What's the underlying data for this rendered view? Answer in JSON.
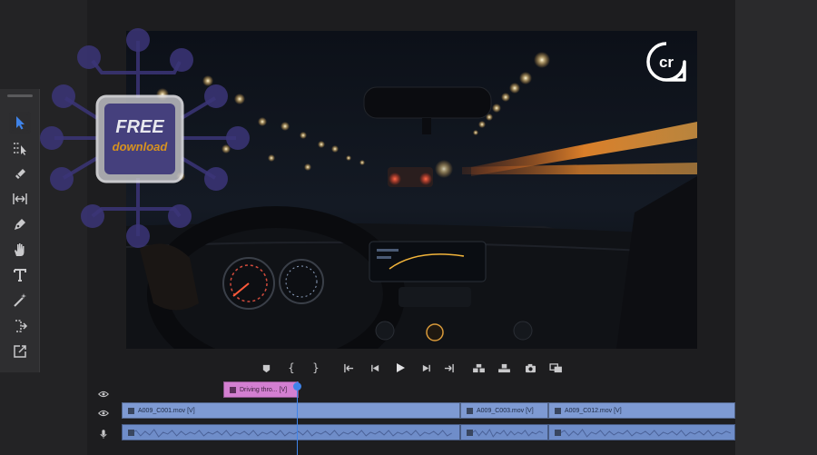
{
  "watermark": {
    "line1": "FREE",
    "line2": "download",
    "logo_text": "cr"
  },
  "tools": [
    {
      "name": "selection-tool",
      "icon": "arrow-pointer-icon",
      "active": true
    },
    {
      "name": "track-select-tool",
      "icon": "track-select-icon",
      "active": false
    },
    {
      "name": "razor-tool",
      "icon": "razor-icon",
      "active": false
    },
    {
      "name": "slip-tool",
      "icon": "slip-icon",
      "active": false
    },
    {
      "name": "pen-tool",
      "icon": "pen-icon",
      "active": false
    },
    {
      "name": "hand-tool",
      "icon": "hand-icon",
      "active": false
    },
    {
      "name": "type-tool",
      "icon": "type-icon",
      "active": false
    },
    {
      "name": "remix-tool",
      "icon": "magic-wand-icon",
      "active": false
    },
    {
      "name": "generative-extend-tool",
      "icon": "extend-icon",
      "active": false
    },
    {
      "name": "export-tool",
      "icon": "export-icon",
      "active": false
    }
  ],
  "transport": [
    {
      "name": "add-marker-button",
      "icon": "marker-icon",
      "glyph": "⬟"
    },
    {
      "name": "mark-in-button",
      "icon": "mark-in-icon",
      "glyph": "{"
    },
    {
      "name": "mark-out-button",
      "icon": "mark-out-icon",
      "glyph": "}"
    },
    {
      "name": "go-to-in-button",
      "icon": "go-to-in-icon",
      "glyph": "⇤"
    },
    {
      "name": "step-back-button",
      "icon": "step-back-icon",
      "glyph": "◀"
    },
    {
      "name": "play-button",
      "icon": "play-icon",
      "glyph": "▶"
    },
    {
      "name": "step-forward-button",
      "icon": "step-forward-icon",
      "glyph": "▶"
    },
    {
      "name": "go-to-out-button",
      "icon": "go-to-out-icon",
      "glyph": "⇥"
    },
    {
      "name": "insert-button",
      "icon": "insert-icon",
      "glyph": "⊞"
    },
    {
      "name": "overwrite-button",
      "icon": "overwrite-icon",
      "glyph": "⊟"
    },
    {
      "name": "export-frame-button",
      "icon": "camera-icon",
      "glyph": "◉"
    },
    {
      "name": "comparison-view-button",
      "icon": "comparison-icon",
      "glyph": "▣"
    }
  ],
  "timeline": {
    "title_clip": "Driving thro... [V]",
    "video_clips": [
      "A009_C001.mov [V]",
      "A009_C003.mov [V]",
      "A009_C012.mov [V]"
    ],
    "track_icons": [
      "eye-icon",
      "eye-icon",
      "microphone-icon"
    ]
  },
  "colors": {
    "accent": "#3f83e8",
    "title_clip": "#d37fd1",
    "video_clip": "#7e9ad3",
    "audio_clip": "#6f8dc9",
    "badge_purple": "#3b3578",
    "badge_orange": "#d7921f"
  }
}
